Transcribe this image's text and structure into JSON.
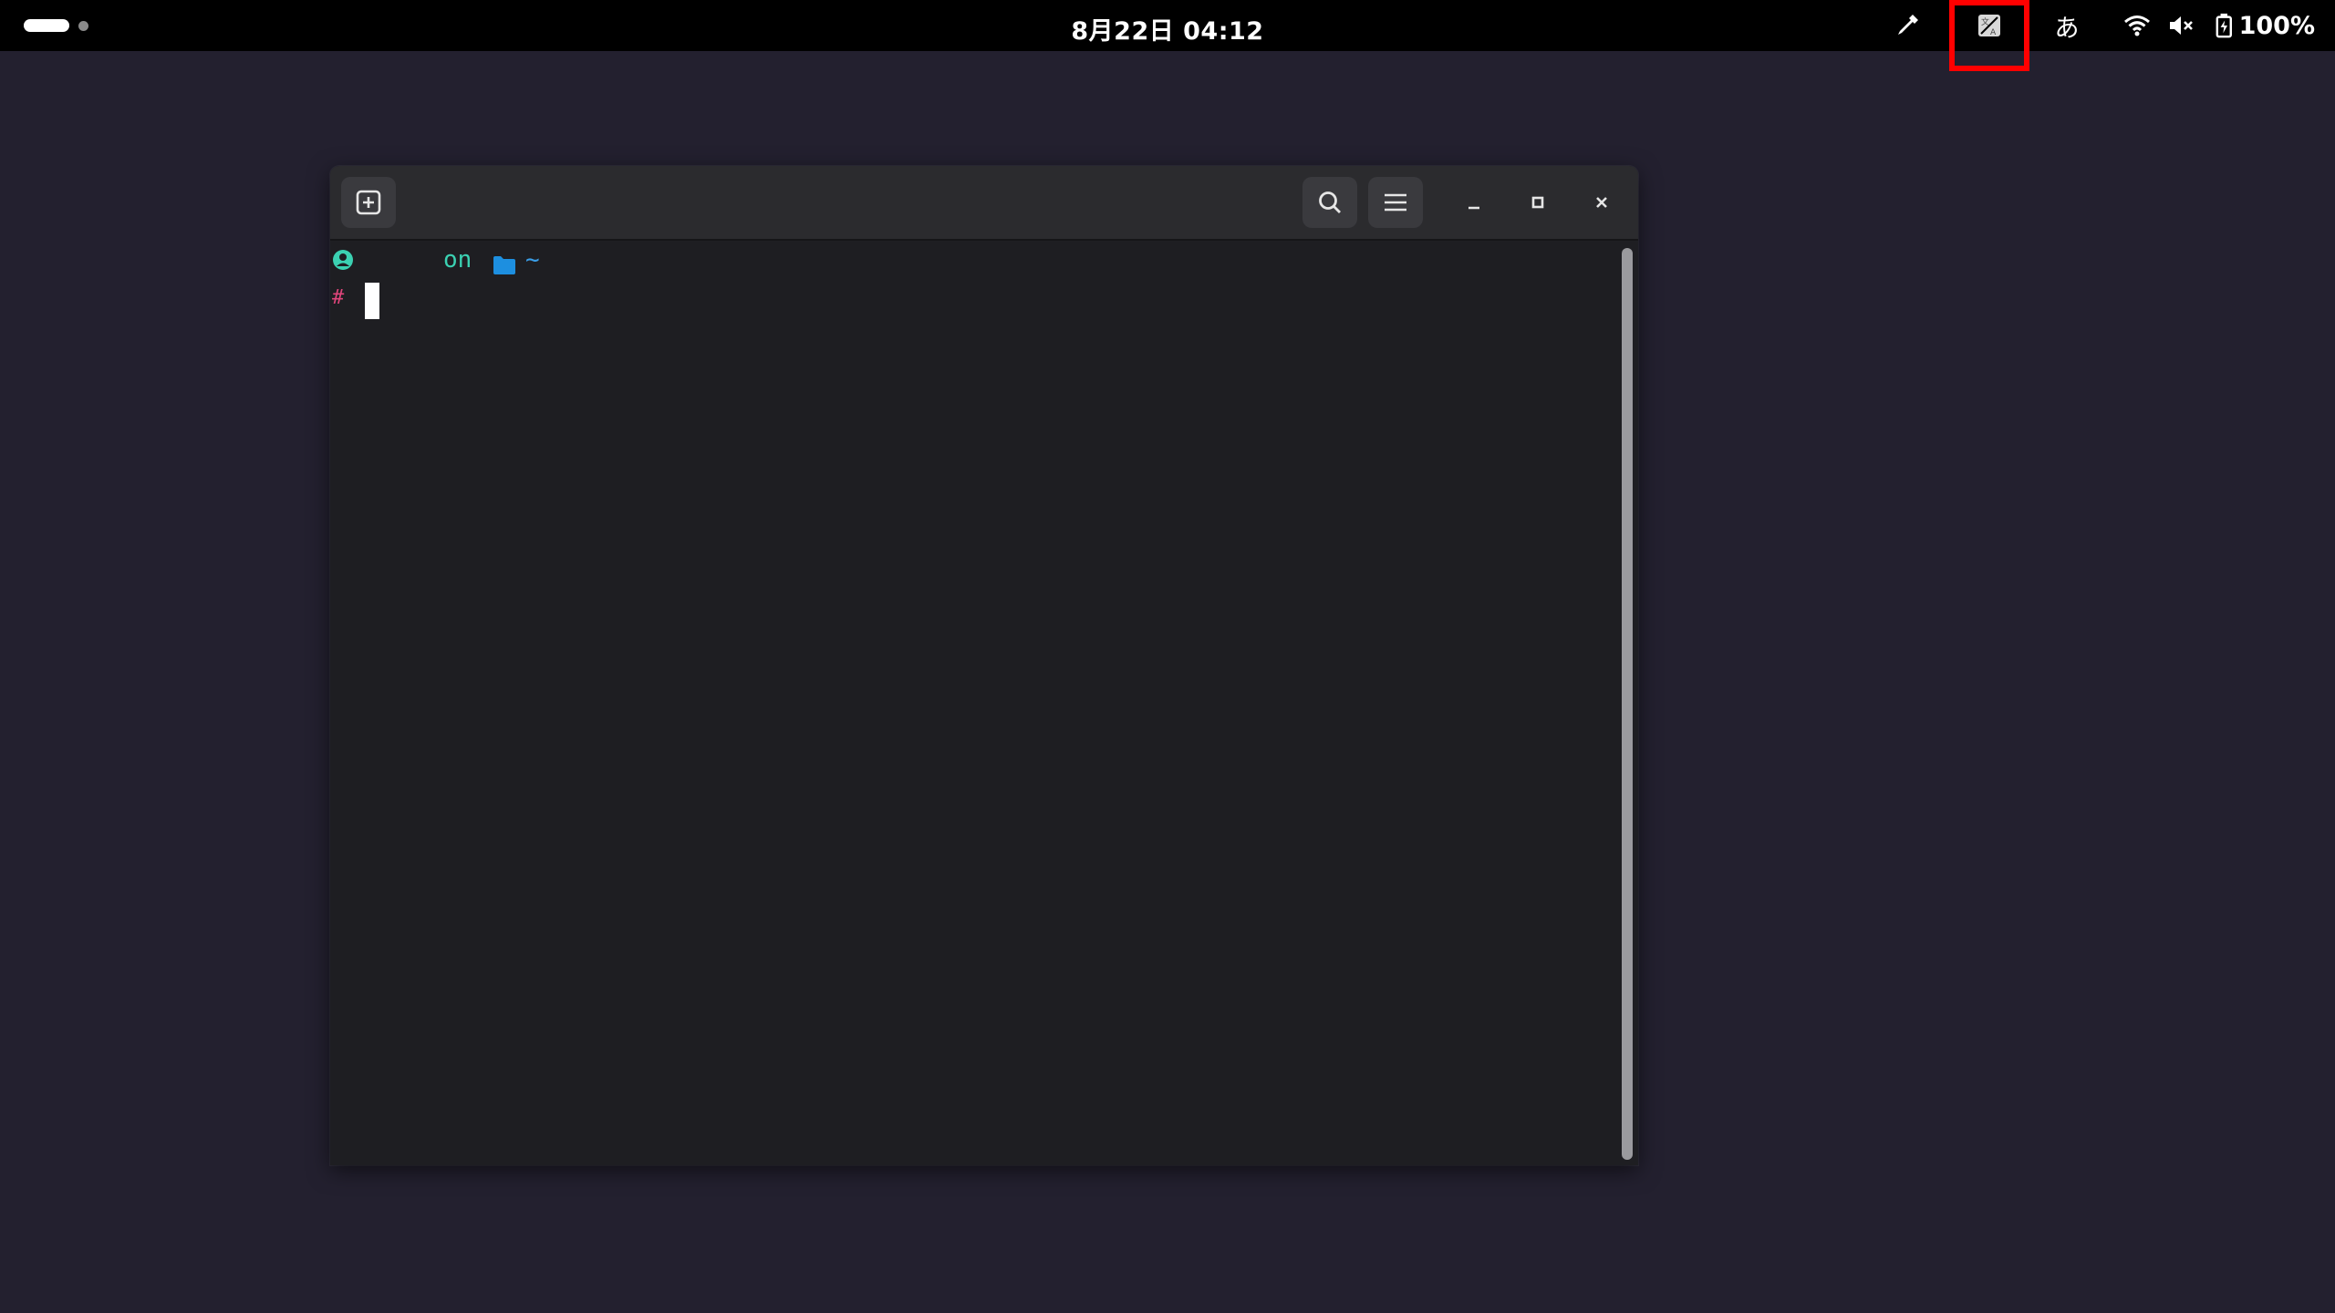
{
  "topbar": {
    "clock": "8月22日  04:12",
    "ime_label": "あ",
    "battery_percent": "100%",
    "icons": {
      "color_picker": "eyedropper-icon",
      "screen_translate": "translate-icon",
      "wifi": "wifi-icon",
      "volume": "volume-muted-icon",
      "battery": "battery-charging-icon"
    }
  },
  "terminal": {
    "header": {
      "new_tab_icon": "new-tab-icon",
      "search_icon": "search-icon",
      "menu_icon": "hamburger-menu-icon",
      "minimize_icon": "minimize-icon",
      "maximize_icon": "maximize-icon",
      "close_icon": "close-icon"
    },
    "prompt": {
      "user_icon": "user-icon",
      "on_text": "on",
      "folder_icon": "folder-icon",
      "path": "~",
      "symbol": "#"
    }
  },
  "colors": {
    "desktop_bg": "#23202f",
    "topbar_bg": "#000000",
    "terminal_bg": "#1e1e22",
    "headerbar_bg": "#2b2b2e",
    "prompt_green": "#3bd1b2",
    "prompt_blue": "#3a9ee8",
    "prompt_pink": "#e0457b",
    "highlight_red": "#ff0000"
  }
}
